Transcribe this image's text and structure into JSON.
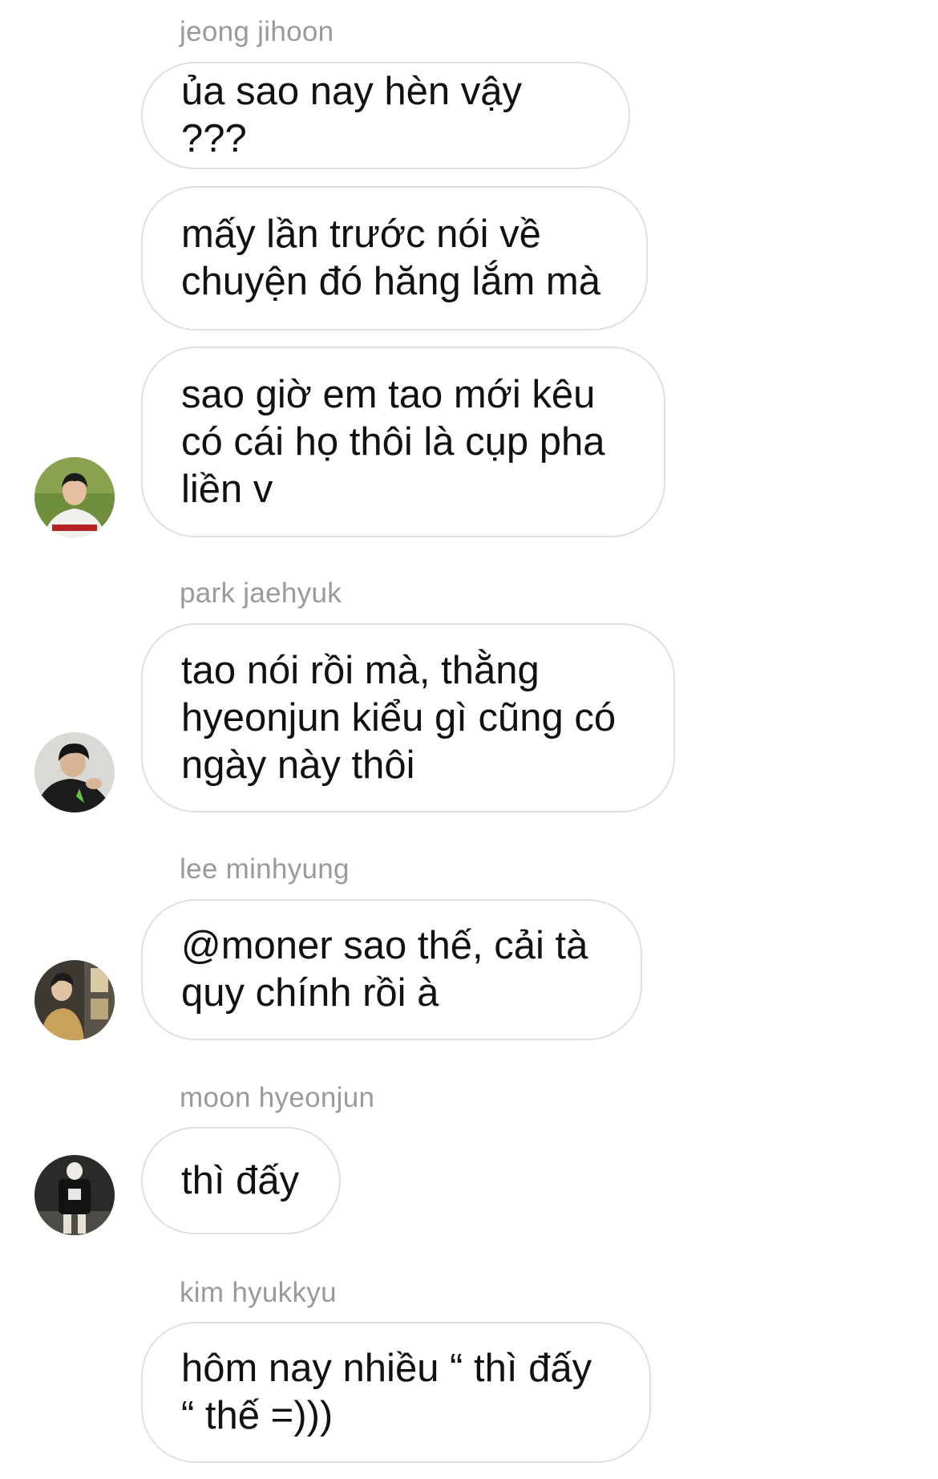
{
  "messages": [
    {
      "sender": "jeong jihoon",
      "text": "ủa sao nay hèn vậy ???"
    },
    {
      "text": "mấy lần trước nói về\nchuyện đó hăng lắm mà"
    },
    {
      "text": "sao giờ em tao mới kêu\ncó cái họ thôi là cụp pha\nliền v"
    },
    {
      "sender": "park jaehyuk",
      "text": "tao nói rồi mà, thằng\nhyeonjun kiểu gì cũng có\nngày này thôi"
    },
    {
      "sender": "lee minhyung",
      "text": "@moner sao thế, cải tà\nquy chính rồi à"
    },
    {
      "sender": "moon hyeonjun",
      "text": "thì đấy"
    },
    {
      "sender": "kim hyukkyu",
      "text": "hôm nay nhiều “ thì đấy\n“ thế =)))"
    }
  ]
}
